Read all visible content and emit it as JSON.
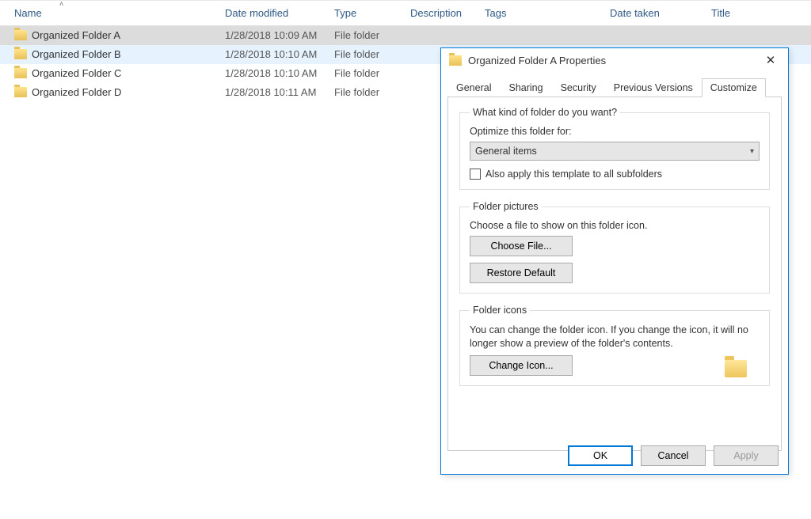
{
  "columns": {
    "name": "Name",
    "modified": "Date modified",
    "type": "Type",
    "description": "Description",
    "tags": "Tags",
    "dateTaken": "Date taken",
    "title": "Title"
  },
  "rows": [
    {
      "name": "Organized Folder A",
      "modified": "1/28/2018 10:09 AM",
      "type": "File folder",
      "state": "selected"
    },
    {
      "name": "Organized Folder B",
      "modified": "1/28/2018 10:10 AM",
      "type": "File folder",
      "state": "hover"
    },
    {
      "name": "Organized Folder C",
      "modified": "1/28/2018 10:10 AM",
      "type": "File folder",
      "state": ""
    },
    {
      "name": "Organized Folder D",
      "modified": "1/28/2018 10:11 AM",
      "type": "File folder",
      "state": ""
    }
  ],
  "dialog": {
    "title": "Organized Folder A Properties",
    "tabs": {
      "general": "General",
      "sharing": "Sharing",
      "security": "Security",
      "previous": "Previous Versions",
      "customize": "Customize"
    },
    "kind": {
      "legend": "What kind of folder do you want?",
      "optimizeLabel": "Optimize this folder for:",
      "selected": "General items",
      "alsoApply": "Also apply this template to all subfolders"
    },
    "pictures": {
      "legend": "Folder pictures",
      "caption": "Choose a file to show on this folder icon.",
      "choose": "Choose File...",
      "restore": "Restore Default"
    },
    "icons": {
      "legend": "Folder icons",
      "caption": "You can change the folder icon. If you change the icon, it will no longer show a preview of the folder's contents.",
      "change": "Change Icon..."
    },
    "buttons": {
      "ok": "OK",
      "cancel": "Cancel",
      "apply": "Apply"
    }
  }
}
